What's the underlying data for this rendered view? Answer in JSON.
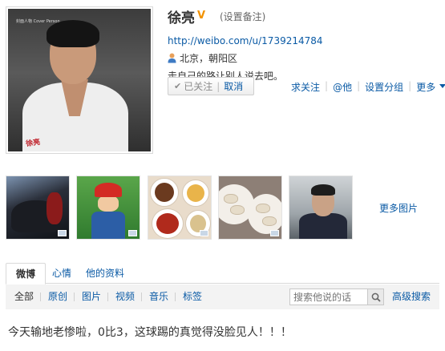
{
  "profile": {
    "name": "徐亮",
    "set_remark": "(设置备注)",
    "url": "http://weibo.com/u/1739214784",
    "location": "北京，朝阳区",
    "bio": "走自己的路让别人说去吧。",
    "avatar_tag": "封面人物  Cover Person",
    "avatar_signature": "徐亮"
  },
  "follow": {
    "followed_label": "已关注",
    "cancel_label": "取消"
  },
  "actions": {
    "ask_follow": "求关注",
    "at_him": "@他",
    "set_group": "设置分组",
    "more": "更多"
  },
  "photos": {
    "more_label": "更多图片"
  },
  "tabs": [
    {
      "label": "微博"
    },
    {
      "label": "心情"
    },
    {
      "label": "他的资料"
    }
  ],
  "filters": [
    {
      "label": "全部"
    },
    {
      "label": "原创"
    },
    {
      "label": "图片"
    },
    {
      "label": "视频"
    },
    {
      "label": "音乐"
    },
    {
      "label": "标签"
    }
  ],
  "search": {
    "placeholder": "搜索他说的话",
    "advanced": "高级搜索"
  },
  "post": {
    "text": "今天输地老惨啦，0比3，这球踢的真觉得没脸见人！！！"
  },
  "colors": {
    "link": "#0a5aa5",
    "verified": "#f29200",
    "subbar_bg": "#f3f3f3"
  }
}
